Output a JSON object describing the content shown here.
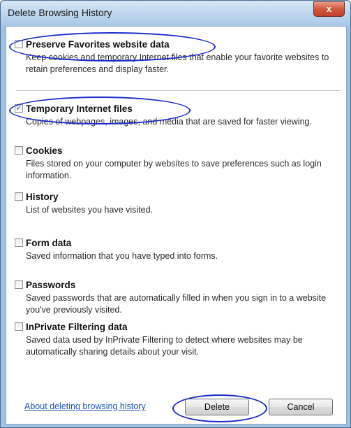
{
  "window": {
    "title": "Delete Browsing History",
    "close_label": "x"
  },
  "options": [
    {
      "label": "Preserve Favorites website data",
      "checked": false,
      "description": "Keep cookies and temporary Internet files that enable your favorite websites to retain preferences and display faster."
    },
    {
      "label": "Temporary Internet files",
      "checked": true,
      "description": "Copies of webpages, images, and media that are saved for faster viewing."
    },
    {
      "label": "Cookies",
      "checked": false,
      "description": "Files stored on your computer by websites to save preferences such as login information."
    },
    {
      "label": "History",
      "checked": false,
      "description": "List of websites you have visited."
    },
    {
      "label": "Form data",
      "checked": false,
      "description": "Saved information that you have typed into forms."
    },
    {
      "label": "Passwords",
      "checked": false,
      "description": "Saved passwords that are automatically filled in when you sign in to a website you've previously visited."
    },
    {
      "label": "InPrivate Filtering data",
      "checked": false,
      "description": "Saved data used by InPrivate Filtering to detect where websites may be automatically sharing details about your visit."
    }
  ],
  "footer": {
    "help_link": "About deleting browsing history",
    "delete_label": "Delete",
    "cancel_label": "Cancel"
  }
}
